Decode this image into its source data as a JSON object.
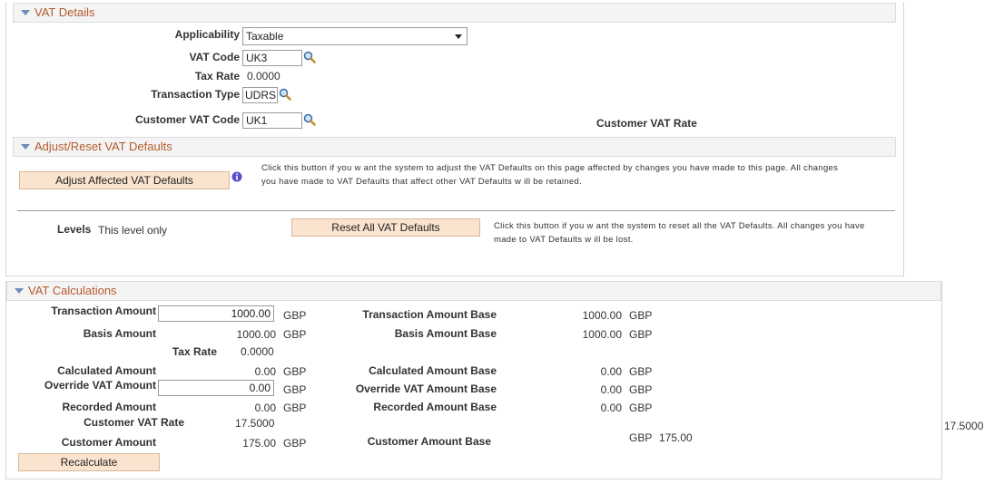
{
  "vat_details": {
    "title": "VAT Details",
    "applicability_label": "Applicability",
    "applicability_value": "Taxable",
    "vat_code_label": "VAT Code",
    "vat_code_value": "UK3",
    "tax_rate_label": "Tax Rate",
    "tax_rate_value": "0.0000",
    "transaction_type_label": "Transaction Type",
    "transaction_type_value": "UDRS",
    "customer_vat_code_label": "Customer VAT Code",
    "customer_vat_code_value": "UK1",
    "customer_vat_rate_label": "Customer VAT Rate"
  },
  "adjust_reset": {
    "title": "Adjust/Reset VAT Defaults",
    "adjust_button": "Adjust Affected VAT Defaults",
    "adjust_help_line1": "Click this button if you w ant the system to adjust the VAT Defaults on this page affected by changes you have made to this page. All changes",
    "adjust_help_line2": "you have made to VAT Defaults that affect other VAT Defaults w ill be retained.",
    "levels_label": "Levels",
    "levels_value": "This level only",
    "reset_button": "Reset All VAT Defaults",
    "reset_help_line1": "Click this button if you w ant the system to reset all the VAT Defaults. All changes you have",
    "reset_help_line2": "made to VAT Defaults w ill be lost."
  },
  "vat_calculations": {
    "title": "VAT Calculations",
    "transaction_amount_label": "Transaction Amount",
    "transaction_amount_value": "1000.00",
    "basis_amount_label": "Basis Amount",
    "basis_amount_value": "1000.00",
    "tax_rate_label": "Tax Rate",
    "tax_rate_value": "0.0000",
    "calculated_amount_label": "Calculated Amount",
    "calculated_amount_value": "0.00",
    "override_vat_amount_label": "Override VAT Amount",
    "override_vat_amount_value": "0.00",
    "recorded_amount_label": "Recorded Amount",
    "recorded_amount_value": "0.00",
    "customer_vat_rate_label": "Customer VAT Rate",
    "customer_vat_rate_value": "17.5000",
    "customer_amount_label": "Customer Amount",
    "customer_amount_value": "175.00",
    "currency": "GBP",
    "transaction_amount_base_label": "Transaction Amount Base",
    "transaction_amount_base_value": "1000.00",
    "basis_amount_base_label": "Basis Amount Base",
    "basis_amount_base_value": "1000.00",
    "calculated_amount_base_label": "Calculated Amount Base",
    "calculated_amount_base_value": "0.00",
    "override_vat_amount_base_label": "Override VAT Amount Base",
    "override_vat_amount_base_value": "0.00",
    "recorded_amount_base_label": "Recorded Amount Base",
    "recorded_amount_base_value": "0.00",
    "customer_amount_base_label": "Customer Amount Base",
    "customer_amount_base_value": "175.00",
    "outside_rate_value": "17.5000",
    "recalculate_button": "Recalculate"
  },
  "colors": {
    "section_title": "#b45a2c",
    "button_bg": "#fbe4cf",
    "header_bg": "#f4f4f4",
    "triangle": "#6e8db8"
  },
  "icons": [
    "collapse-triangle-icon",
    "lookup-magnifier-icon",
    "info-icon",
    "dropdown-arrow-icon"
  ]
}
